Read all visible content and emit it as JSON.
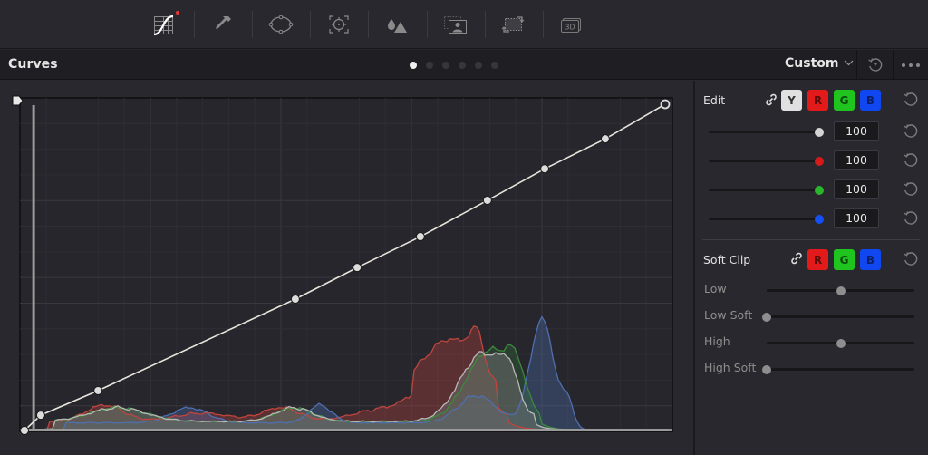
{
  "toolbar": {
    "tools": [
      {
        "name": "curves-tool",
        "icon": "curves-grid-icon",
        "active": true,
        "has_indicator": true
      },
      {
        "name": "qualifier-tool",
        "icon": "eyedropper-icon",
        "active": false
      },
      {
        "name": "window-tool",
        "icon": "power-window-icon",
        "active": false
      },
      {
        "name": "tracker-tool",
        "icon": "tracker-target-icon",
        "active": false
      },
      {
        "name": "blur-tool",
        "icon": "blur-drops-icon",
        "active": false
      },
      {
        "name": "key-tool",
        "icon": "key-portrait-icon",
        "active": false
      },
      {
        "name": "sizing-tool",
        "icon": "sizing-icon",
        "active": false
      },
      {
        "name": "3d-tool",
        "icon": "3d-icon",
        "active": false,
        "label": "3D"
      }
    ],
    "indicator_color": "#e53535"
  },
  "header": {
    "title": "Curves",
    "pages": 6,
    "active_page": 0,
    "preset": "Custom",
    "preset_chevron": "⌵"
  },
  "curve": {
    "control_points": [
      [
        0,
        0
      ],
      [
        0.025,
        0.046
      ],
      [
        0.113,
        0.12
      ],
      [
        0.416,
        0.395
      ],
      [
        0.511,
        0.49
      ],
      [
        0.608,
        0.583
      ],
      [
        0.711,
        0.692
      ],
      [
        0.799,
        0.787
      ],
      [
        0.892,
        0.877
      ],
      [
        0.984,
        0.981
      ]
    ],
    "end_point_open": true,
    "color": "#e8e4dc"
  },
  "histogram": {
    "colors": {
      "red": "#c0453e",
      "green": "#3c8a3c",
      "blue": "#4f6fae",
      "luma": "#b8b8b8"
    },
    "spike_x": 0.021
  },
  "edit": {
    "label": "Edit",
    "channels": [
      {
        "key": "Y",
        "bg": "#e0e0e0",
        "fg": "#333333"
      },
      {
        "key": "R",
        "bg": "#e31a1a",
        "fg": "#5a0a0a"
      },
      {
        "key": "G",
        "bg": "#1fc41f",
        "fg": "#0c4a0c"
      },
      {
        "key": "B",
        "bg": "#1147f0",
        "fg": "#0a1f66"
      }
    ],
    "sliders": [
      {
        "channel": "Y",
        "value": "100",
        "fraction": 1.0,
        "color": "#d4d4d4"
      },
      {
        "channel": "R",
        "value": "100",
        "fraction": 1.0,
        "color": "#d61a1a"
      },
      {
        "channel": "G",
        "value": "100",
        "fraction": 1.0,
        "color": "#2ab52a"
      },
      {
        "channel": "B",
        "value": "100",
        "fraction": 1.0,
        "color": "#1450f5"
      }
    ]
  },
  "soft_clip": {
    "label": "Soft Clip",
    "channels": [
      {
        "key": "R",
        "bg": "#e31a1a",
        "fg": "#5a0a0a"
      },
      {
        "key": "G",
        "bg": "#1fc41f",
        "fg": "#0c4a0c"
      },
      {
        "key": "B",
        "bg": "#1147f0",
        "fg": "#0a1f66"
      }
    ],
    "sliders": [
      {
        "label": "Low",
        "fraction": 0.5
      },
      {
        "label": "Low Soft",
        "fraction": 0.0
      },
      {
        "label": "High",
        "fraction": 0.5
      },
      {
        "label": "High Soft",
        "fraction": 0.0
      }
    ]
  }
}
